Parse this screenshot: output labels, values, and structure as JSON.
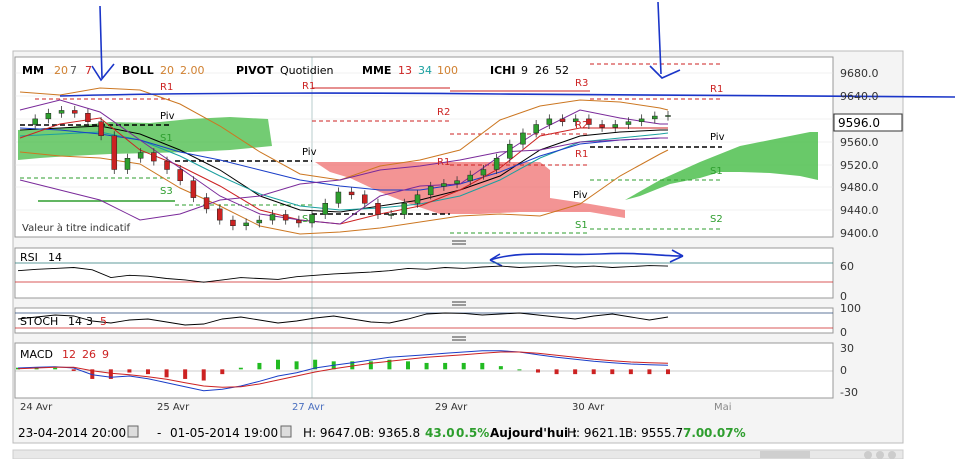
{
  "header": {
    "mm_label": "MM",
    "mm_params": [
      "20",
      "7",
      "7"
    ],
    "boll_label": "BOLL",
    "boll_params": [
      "20",
      "2.00"
    ],
    "pivot_label": "PIVOT",
    "pivot_period": "Quotidien",
    "mme_label": "MME",
    "mme_params": [
      "13",
      "34",
      "100"
    ],
    "ichi_label": "ICHI",
    "ichi_params": [
      "9",
      "26",
      "52"
    ]
  },
  "price_axis": {
    "ticks": [
      "9680.0",
      "9640.0",
      "9600.0",
      "9560.0",
      "9520.0",
      "9480.0",
      "9440.0",
      "9400.0"
    ],
    "current_value": "9596.0"
  },
  "pivot_labels": {
    "r3": "R3",
    "r2": "R2",
    "r1": "R1",
    "piv": "Piv",
    "s1": "S1",
    "s2": "S2",
    "s3": "S3"
  },
  "watermark": "Valeur à titre indicatif",
  "rsi": {
    "label": "RSI",
    "period": "14",
    "ticks": [
      "60",
      "0"
    ]
  },
  "stoch": {
    "label": "STOCH",
    "params": [
      "14",
      "3",
      "5"
    ],
    "ticks": [
      "100",
      "0"
    ]
  },
  "macd": {
    "label": "MACD",
    "params": [
      "12",
      "26",
      "9"
    ],
    "ticks": [
      "30",
      "0",
      "-30"
    ]
  },
  "date_axis": [
    "24 Avr",
    "25 Avr",
    "27 Avr",
    "29 Avr",
    "30 Avr",
    "Mai"
  ],
  "status_bar": {
    "from": "23-04-2014 20:00",
    "sep": "-",
    "to": "01-05-2014 19:00",
    "period_high": "H: 9647.0",
    "period_low": "B: 9365.8",
    "period_change": "43.0",
    "period_change_pct": "0.5%",
    "today_label": "Aujourd'hui :",
    "today_high": "H: 9621.1",
    "today_low": "B: 9555.7",
    "today_change": "7.0",
    "today_change_pct": "0.07%"
  },
  "colors": {
    "bull": "#2e9e2e",
    "bear": "#cc2222",
    "cloud_green": "#44bb44",
    "cloud_red": "#ee6666",
    "bollinger": "#cc7722",
    "annotation": "#1a35c8",
    "rsi_line": "#6b8a8a"
  },
  "chart_data": [
    {
      "type": "candlestick",
      "title": "",
      "ylim": [
        9380,
        9700
      ],
      "x": [
        "24 Avr",
        "25 Avr",
        "27 Avr",
        "29 Avr",
        "30 Avr",
        "Mai"
      ],
      "close_path": [
        9580,
        9590,
        9600,
        9605,
        9600,
        9585,
        9560,
        9500,
        9520,
        9530,
        9515,
        9500,
        9480,
        9450,
        9430,
        9410,
        9400,
        9405,
        9410,
        9420,
        9410,
        9405,
        9420,
        9440,
        9460,
        9455,
        9440,
        9420,
        9420,
        9440,
        9455,
        9470,
        9475,
        9480,
        9490,
        9500,
        9520,
        9545,
        9565,
        9580,
        9590,
        9585,
        9590,
        9580,
        9575,
        9580,
        9585,
        9590,
        9595,
        9596
      ],
      "pivot_levels_left": {
        "R1": 9650,
        "Piv": 9580,
        "S1": 9500,
        "S3": 9460
      },
      "pivot_levels_right": {
        "R3": 9676,
        "R2": 9642,
        "R1": 9606,
        "Piv": 9565,
        "S1": 9500,
        "S2": 9408
      },
      "resistance_annotation": 9638
    },
    {
      "type": "line",
      "title": "",
      "name": "RSI 14",
      "ylim": [
        0,
        100
      ],
      "levels": [
        70,
        30
      ],
      "values": [
        55,
        58,
        60,
        62,
        57,
        40,
        45,
        43,
        38,
        35,
        30,
        35,
        40,
        38,
        36,
        42,
        45,
        48,
        50,
        52,
        55,
        60,
        58,
        62,
        60,
        63,
        65,
        62,
        64,
        66,
        63,
        65,
        62,
        64,
        66,
        65
      ]
    },
    {
      "type": "line",
      "title": "",
      "name": "STOCH 14 3 5",
      "ylim": [
        0,
        100
      ],
      "values": [
        60,
        70,
        80,
        75,
        50,
        40,
        55,
        60,
        45,
        30,
        35,
        60,
        70,
        55,
        40,
        50,
        65,
        75,
        60,
        45,
        40,
        60,
        85,
        90,
        88,
        80,
        85,
        90,
        80,
        70,
        60,
        75,
        85,
        70,
        55,
        70
      ]
    },
    {
      "type": "line",
      "title": "",
      "name": "MACD 12 26 9",
      "ylim": [
        -40,
        35
      ],
      "macd": [
        2,
        3,
        4,
        2,
        -8,
        -12,
        -10,
        -14,
        -20,
        -26,
        -32,
        -30,
        -25,
        -18,
        -10,
        -5,
        2,
        6,
        10,
        14,
        18,
        20,
        22,
        24,
        26,
        28,
        28,
        26,
        22,
        18,
        15,
        12,
        10,
        8,
        7,
        6
      ],
      "signal": [
        1,
        2,
        3,
        3,
        -2,
        -6,
        -8,
        -11,
        -15,
        -20,
        -25,
        -27,
        -26,
        -22,
        -16,
        -10,
        -4,
        1,
        5,
        9,
        12,
        15,
        18,
        20,
        22,
        24,
        26,
        26,
        24,
        21,
        18,
        15,
        13,
        11,
        10,
        9
      ]
    }
  ]
}
